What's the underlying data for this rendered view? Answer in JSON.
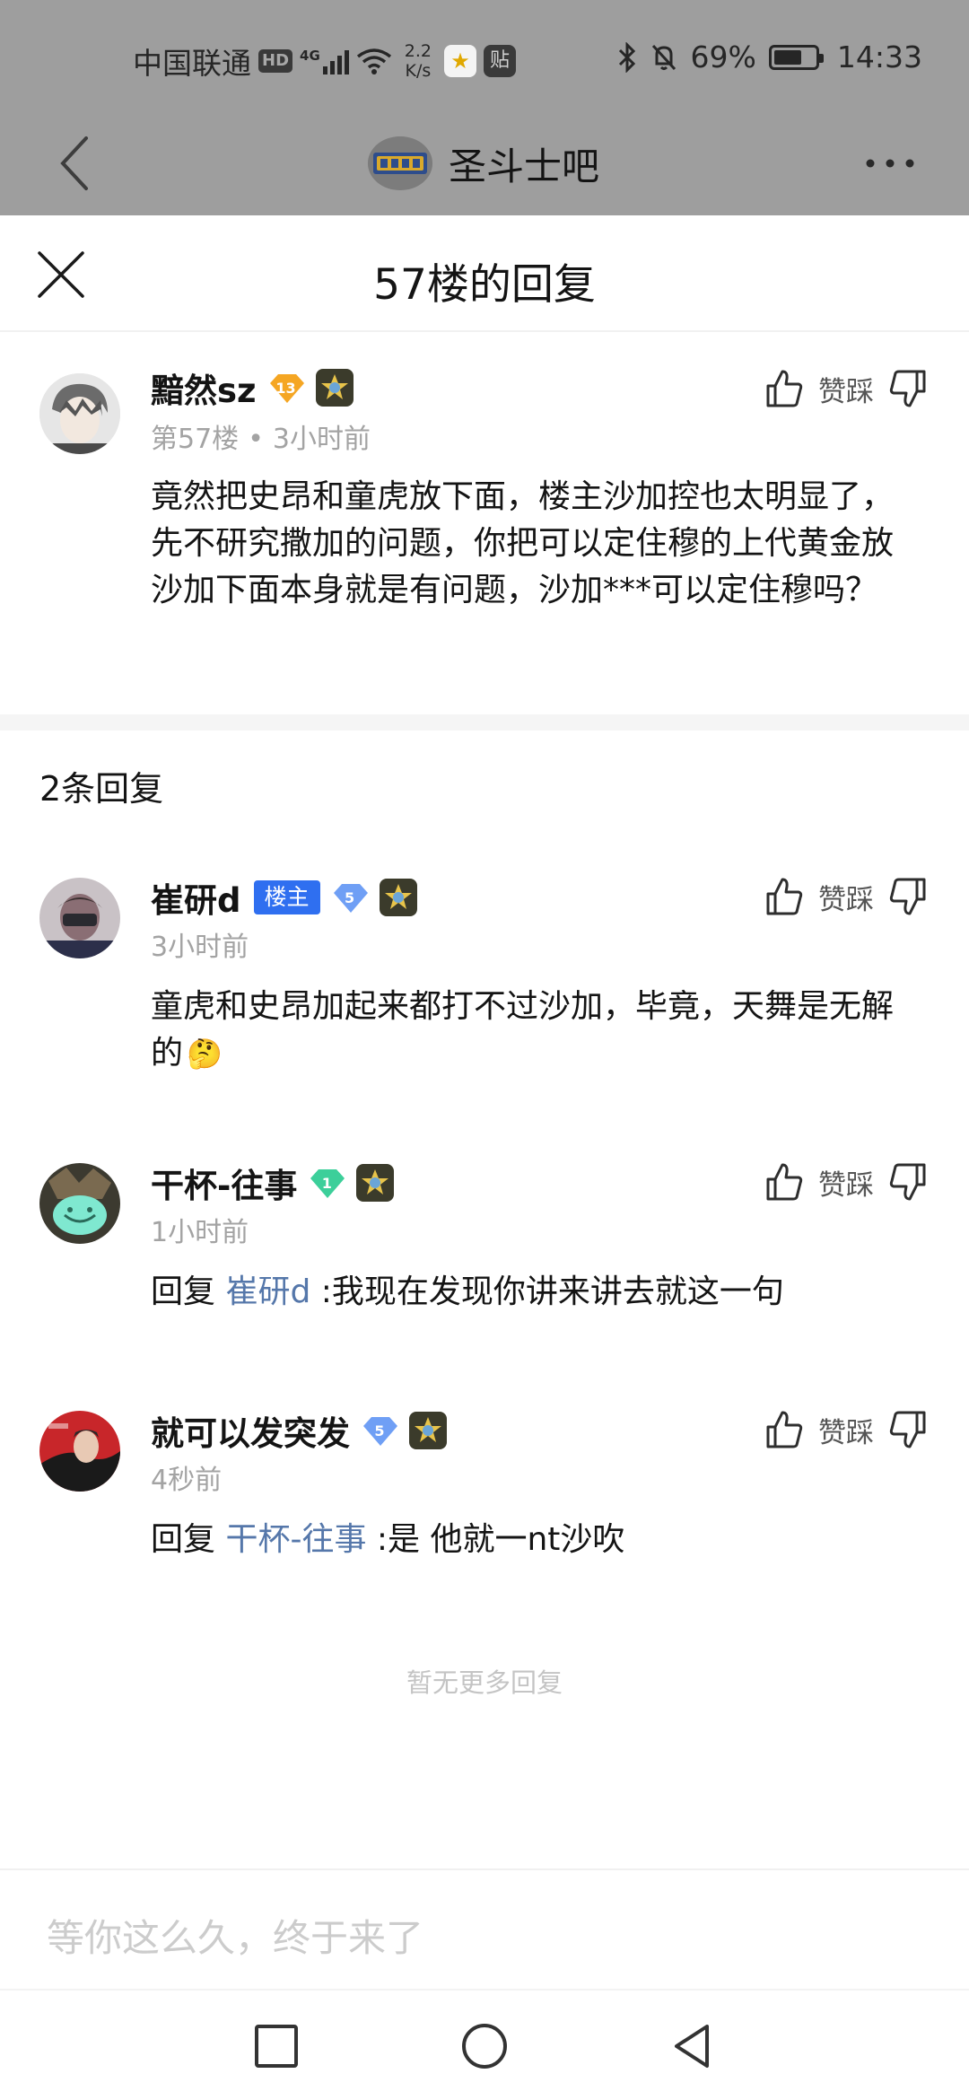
{
  "status_bar": {
    "carrier": "中国联通",
    "hd": "HD",
    "network": "4G",
    "speed_value": "2.2",
    "speed_unit": "K/s",
    "app_badge": "贴",
    "battery": "69%",
    "battery_level": 0.69,
    "time": "14:33"
  },
  "nav": {
    "title": "圣斗士吧"
  },
  "sheet": {
    "title": "57楼的回复"
  },
  "main_post": {
    "username": "黯然sz",
    "level": "13",
    "floor": "第57楼",
    "sep": "•",
    "time": "3小时前",
    "vote_label": "赞踩",
    "content": "竟然把史昂和童虎放下面，楼主沙加控也太明显了，先不研究撒加的问题，你把可以定住穆的上代黄金放沙加下面本身就是有问题，沙加***可以定住穆吗？"
  },
  "replies_header": "2条回复",
  "replies": [
    {
      "username": "崔研d",
      "owner_tag": "楼主",
      "level": "5",
      "time": "3小时前",
      "vote_label": "赞踩",
      "content": "童虎和史昂加起来都打不过沙加，毕竟，天舞是无解的",
      "emoji": "🤔"
    },
    {
      "username": "干杯-往事",
      "level": "1",
      "time": "1小时前",
      "vote_label": "赞踩",
      "reply_prefix": "回复 ",
      "reply_to": "崔研d",
      "content": " :我现在发现你讲来讲去就这一句"
    },
    {
      "username": "就可以发突发",
      "level": "5",
      "time": "4秒前",
      "vote_label": "赞踩",
      "reply_prefix": "回复 ",
      "reply_to": "干杯-往事",
      "content": " :是 他就一nt沙吹"
    }
  ],
  "no_more": "暂无更多回复",
  "input": {
    "placeholder": "等你这么久，终于来了"
  },
  "colors": {
    "owner_tag": "#2f6ff0",
    "mention": "#5577aa",
    "level_gold": "#f5a623",
    "level_blue": "#6f9ff5",
    "level_green": "#3ccf9a"
  }
}
